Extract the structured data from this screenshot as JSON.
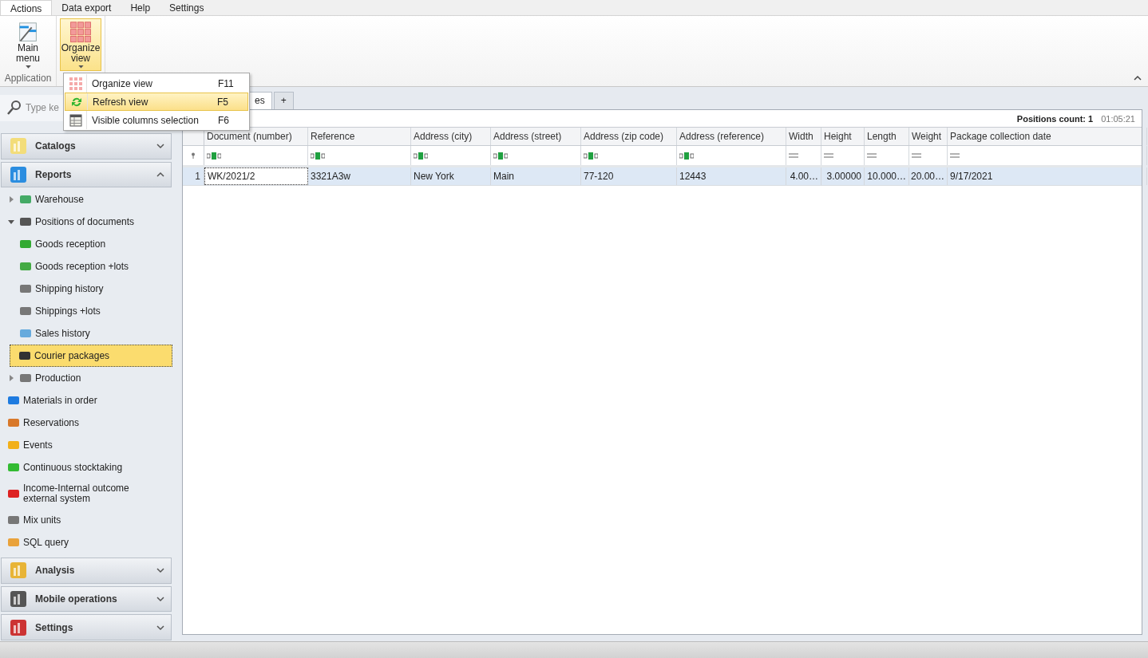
{
  "ribbon": {
    "tabs": [
      {
        "label": "Actions",
        "selected": true
      },
      {
        "label": "Data export",
        "selected": false
      },
      {
        "label": "Help",
        "selected": false
      },
      {
        "label": "Settings",
        "selected": false
      }
    ],
    "groups": [
      {
        "label": "Application",
        "buttons": [
          {
            "label": "Main menu",
            "pressed": false
          }
        ]
      },
      {
        "buttons": [
          {
            "label": "Organize view",
            "pressed": true
          }
        ]
      }
    ]
  },
  "dropdown_menu": [
    {
      "label": "Organize view",
      "shortcut": "F11",
      "selected": false
    },
    {
      "label": "Refresh view",
      "shortcut": "F5",
      "selected": true
    },
    {
      "label": "Visible columns selection",
      "shortcut": "F6",
      "selected": false
    }
  ],
  "sidebar": {
    "search": {
      "placeholder": "Type ke"
    },
    "sections": [
      {
        "title": "Catalogs",
        "expanded": false
      },
      {
        "title": "Reports",
        "expanded": true,
        "items": [
          {
            "label": "Warehouse",
            "expanded": false,
            "selected": false
          },
          {
            "label": "Positions of documents",
            "expanded": true,
            "selected": false,
            "children": [
              {
                "label": "Goods reception",
                "selected": false
              },
              {
                "label": "Goods reception +lots",
                "selected": false
              },
              {
                "label": "Shipping history",
                "selected": false
              },
              {
                "label": "Shippings +lots",
                "selected": false
              },
              {
                "label": "Sales history",
                "selected": false
              },
              {
                "label": "Courier packages",
                "selected": true
              }
            ]
          },
          {
            "label": "Production",
            "expanded": false,
            "selected": false
          },
          {
            "label": "Materials in order",
            "selected": false
          },
          {
            "label": "Reservations",
            "selected": false
          },
          {
            "label": "Events",
            "selected": false
          },
          {
            "label": "Continuous stocktaking",
            "selected": false
          },
          {
            "label": "Income-Internal outcome external system",
            "selected": false
          },
          {
            "label": "Mix units",
            "selected": false
          },
          {
            "label": "SQL query",
            "selected": false
          }
        ]
      },
      {
        "title": "Analysis",
        "expanded": false
      },
      {
        "title": "Mobile operations",
        "expanded": false
      },
      {
        "title": "Settings",
        "expanded": false
      }
    ]
  },
  "document_tabs": [
    {
      "label": "es",
      "selected": true
    },
    {
      "label": "+",
      "selected": false
    }
  ],
  "grid": {
    "positions_count": "Positions count: 1",
    "time": "01:05:21",
    "columns": [
      {
        "label": "Document (number)",
        "kind": "text"
      },
      {
        "label": "Reference",
        "kind": "text"
      },
      {
        "label": "Address (city)",
        "kind": "text"
      },
      {
        "label": "Address (street)",
        "kind": "text"
      },
      {
        "label": "Address (zip code)",
        "kind": "text"
      },
      {
        "label": "Address (reference)",
        "kind": "text"
      },
      {
        "label": "Width",
        "kind": "number"
      },
      {
        "label": "Height",
        "kind": "number"
      },
      {
        "label": "Length",
        "kind": "number"
      },
      {
        "label": "Weight",
        "kind": "number"
      },
      {
        "label": "Package collection date",
        "kind": "number"
      }
    ],
    "rows": [
      {
        "number": "1",
        "selected": true,
        "cells": [
          "WK/2021/2",
          "3321A3w",
          "New York",
          "Main",
          "77-120",
          "12443",
          "4.00…",
          "3.00000",
          "10.000…",
          "20.00…",
          "9/17/2021"
        ]
      }
    ]
  }
}
